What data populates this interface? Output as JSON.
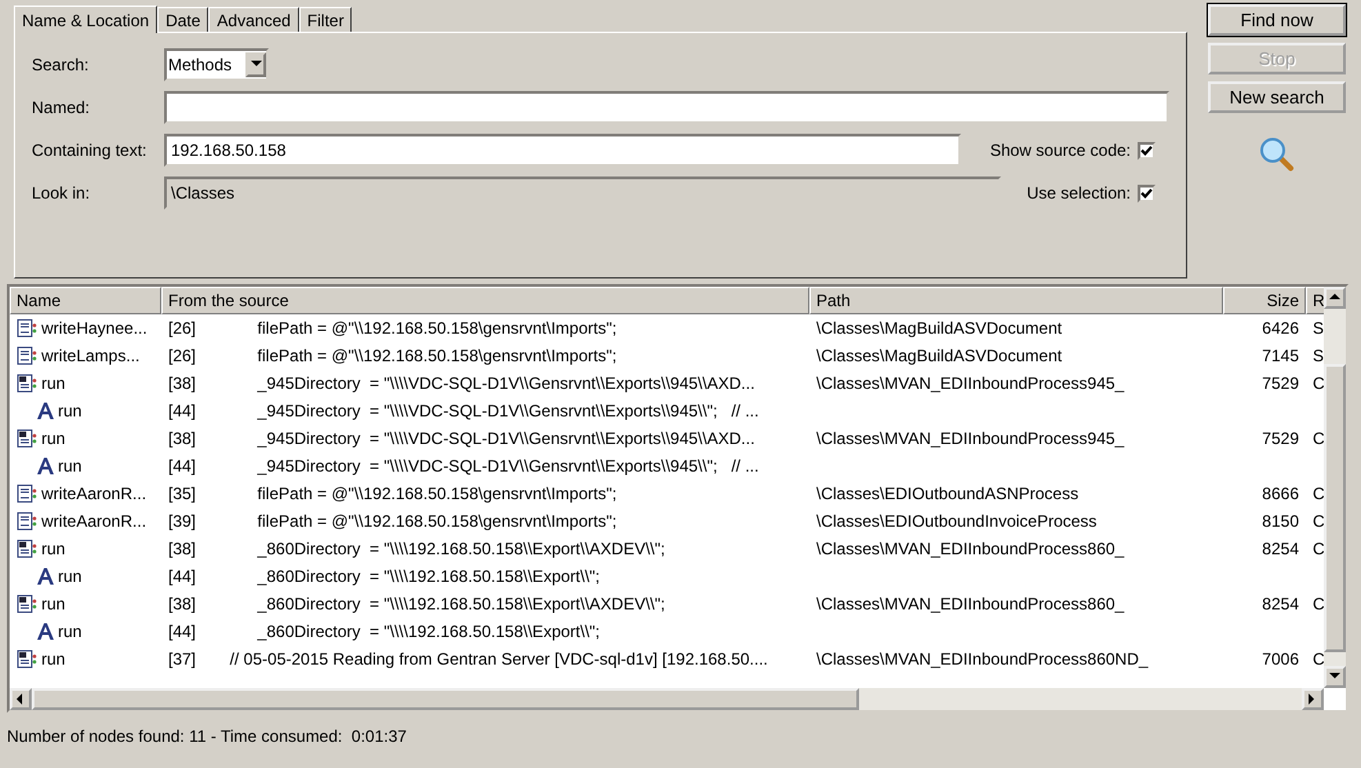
{
  "tabs": [
    {
      "label": "Name & Location",
      "selected": true
    },
    {
      "label": "Date",
      "selected": false
    },
    {
      "label": "Advanced",
      "selected": false
    },
    {
      "label": "Filter",
      "selected": false
    }
  ],
  "form": {
    "search_label": "Search:",
    "search_value": "Methods",
    "named_label": "Named:",
    "containing_label": "Containing text:",
    "containing_value": "192.168.50.158",
    "look_in_label": "Look in:",
    "look_in_value": "\\Classes",
    "show_source_label": "Show source code:",
    "show_source_checked": true,
    "use_selection_label": "Use selection:",
    "use_selection_checked": true
  },
  "buttons": [
    {
      "label": "Find now",
      "disabled": false
    },
    {
      "label": "Stop",
      "disabled": true
    },
    {
      "label": "New search",
      "disabled": false
    }
  ],
  "table": {
    "columns": [
      "Name",
      "From the source",
      "Path",
      "Size",
      "R"
    ],
    "rows": [
      {
        "kind": "method",
        "name": "writeHaynee...",
        "line": "[26]",
        "source": "        filePath = @\"\\\\192.168.50.158\\gensrvnt\\Imports\";",
        "path": "\\Classes\\MagBuildASVDocument",
        "size": "6426",
        "r": "S"
      },
      {
        "kind": "method",
        "name": "writeLamps...",
        "line": "[26]",
        "source": "        filePath = @\"\\\\192.168.50.158\\gensrvnt\\Imports\";",
        "path": "\\Classes\\MagBuildASVDocument",
        "size": "7145",
        "r": "S"
      },
      {
        "kind": "job",
        "name": "run",
        "line": "[38]",
        "source": "        _945Directory  = \"\\\\\\\\VDC-SQL-D1V\\\\Gensrvnt\\\\Exports\\\\945\\\\AXD...",
        "path": "\\Classes\\MVAN_EDIInboundProcess945_",
        "size": "7529",
        "r": "C"
      },
      {
        "kind": "field",
        "name": "run",
        "line": "[44]",
        "source": "        _945Directory  = \"\\\\\\\\VDC-SQL-D1V\\\\Gensrvnt\\\\Exports\\\\945\\\\\";   // ..."
      },
      {
        "kind": "job",
        "name": "run",
        "line": "[38]",
        "source": "        _945Directory  = \"\\\\\\\\VDC-SQL-D1V\\\\Gensrvnt\\\\Exports\\\\945\\\\AXD...",
        "path": "\\Classes\\MVAN_EDIInboundProcess945_",
        "size": "7529",
        "r": "C"
      },
      {
        "kind": "field",
        "name": "run",
        "line": "[44]",
        "source": "        _945Directory  = \"\\\\\\\\VDC-SQL-D1V\\\\Gensrvnt\\\\Exports\\\\945\\\\\";   // ..."
      },
      {
        "kind": "method",
        "name": "writeAaronR...",
        "line": "[35]",
        "source": "        filePath = @\"\\\\192.168.50.158\\gensrvnt\\Imports\";",
        "path": "\\Classes\\EDIOutboundASNProcess",
        "size": "8666",
        "r": "C"
      },
      {
        "kind": "method",
        "name": "writeAaronR...",
        "line": "[39]",
        "source": "        filePath = @\"\\\\192.168.50.158\\gensrvnt\\Imports\";",
        "path": "\\Classes\\EDIOutboundInvoiceProcess",
        "size": "8150",
        "r": "C"
      },
      {
        "kind": "job",
        "name": "run",
        "line": "[38]",
        "source": "        _860Directory  = \"\\\\\\\\192.168.50.158\\\\Export\\\\AXDEV\\\\\";",
        "path": "\\Classes\\MVAN_EDIInboundProcess860_",
        "size": "8254",
        "r": "C"
      },
      {
        "kind": "field",
        "name": "run",
        "line": "[44]",
        "source": "        _860Directory  = \"\\\\\\\\192.168.50.158\\\\Export\\\\\";"
      },
      {
        "kind": "job",
        "name": "run",
        "line": "[38]",
        "source": "        _860Directory  = \"\\\\\\\\192.168.50.158\\\\Export\\\\AXDEV\\\\\";",
        "path": "\\Classes\\MVAN_EDIInboundProcess860_",
        "size": "8254",
        "r": "C"
      },
      {
        "kind": "field",
        "name": "run",
        "line": "[44]",
        "source": "        _860Directory  = \"\\\\\\\\192.168.50.158\\\\Export\\\\\";"
      },
      {
        "kind": "job",
        "name": "run",
        "line": "[37]",
        "source": "  // 05-05-2015 Reading from Gentran Server [VDC-sql-d1v] [192.168.50....",
        "path": "\\Classes\\MVAN_EDIInboundProcess860ND_",
        "size": "7006",
        "r": "C"
      }
    ]
  },
  "status": "Number of nodes found: 11 - Time consumed:  0:01:37"
}
